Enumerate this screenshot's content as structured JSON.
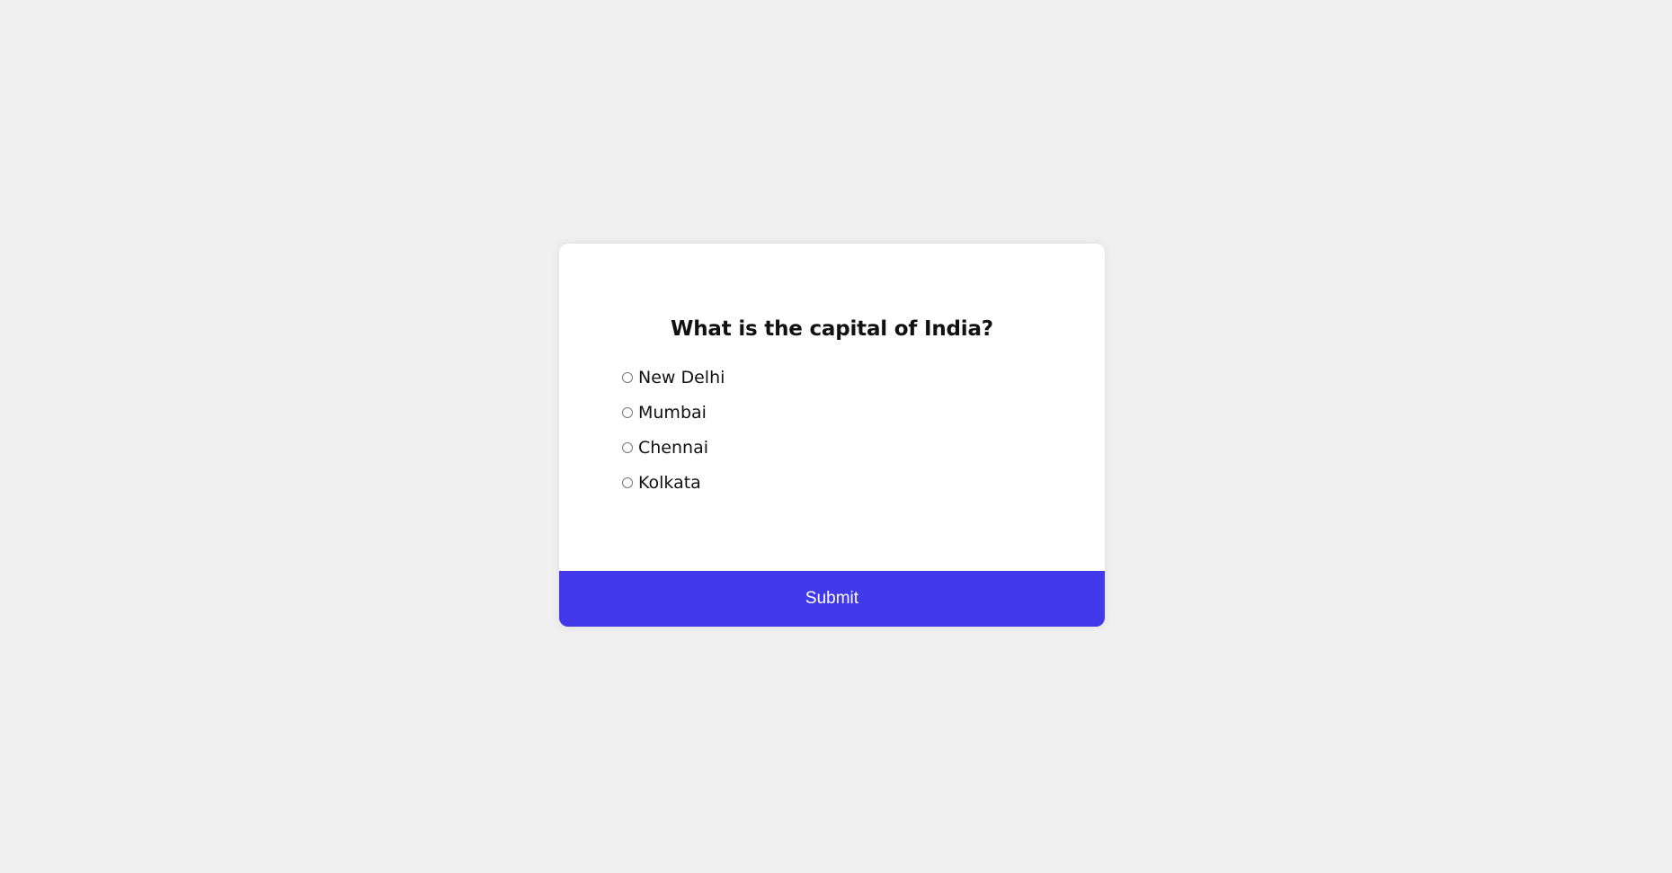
{
  "quiz": {
    "question": "What is the capital of India?",
    "answers": [
      {
        "label": "New Delhi",
        "selected": false
      },
      {
        "label": "Mumbai",
        "selected": false
      },
      {
        "label": "Chennai",
        "selected": false
      },
      {
        "label": "Kolkata",
        "selected": false
      }
    ],
    "submit_label": "Submit"
  },
  "colors": {
    "background": "#f0f0f0",
    "card": "#ffffff",
    "accent": "#4139ea",
    "text": "#111111"
  }
}
